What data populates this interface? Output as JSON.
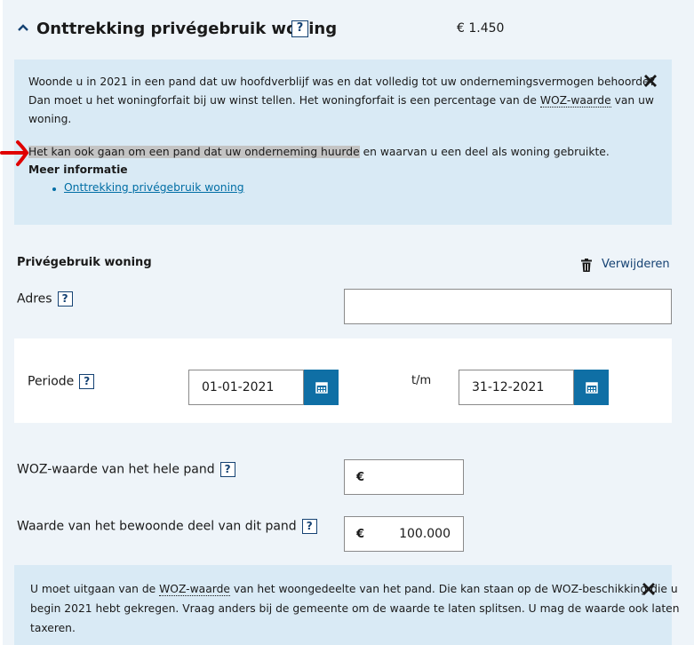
{
  "section": {
    "title": "Onttrekking privégebruik woning",
    "help": "?",
    "amount": "€ 1.450"
  },
  "info1": {
    "line1": "Woonde u in 2021 in een pand dat uw hoofdverblijf was en dat volledig tot uw ondernemingsvermogen behoorde?",
    "line2a": "Dan moet u het woningforfait bij uw winst tellen. Het woningforfait is een percentage van de ",
    "line2_link": "WOZ-waarde",
    "line2b": " van uw",
    "line3": "woning.",
    "highlight": "Het kan ook gaan om een pand dat uw onderneming huurde",
    "after_highlight": " en waarvan u een deel als woning gebruikte.",
    "more_title": "Meer informatie",
    "more_link": "Onttrekking privégebruik woning"
  },
  "privegebruik": {
    "title": "Privégebruik woning",
    "delete_label": "Verwijderen",
    "adres_label": "Adres",
    "adres_value": "",
    "help": "?"
  },
  "periode": {
    "label": "Periode",
    "from": "01-01-2021",
    "separator": "t/m",
    "to": "31-12-2021"
  },
  "woz": {
    "label": "WOZ-waarde van het hele pand",
    "currency": "€",
    "value": ""
  },
  "bewoond": {
    "label": "Waarde van het bewoonde deel van dit pand",
    "currency": "€",
    "value": "100.000"
  },
  "info2": {
    "line1a": "U moet uitgaan van de ",
    "line1_link": "WOZ-waarde",
    "line1b": " van het woongedeelte van het pand. Die kan staan op de WOZ-beschikking die u",
    "line2": "begin 2021 hebt gekregen. Vraag anders bij de gemeente om de waarde te laten splitsen. U mag de waarde ook laten",
    "line3": "taxeren."
  },
  "colors": {
    "accent": "#154273",
    "button": "#0f6fa5",
    "info_bg": "#d9eaf5",
    "annotation_arrow": "#e00000"
  }
}
